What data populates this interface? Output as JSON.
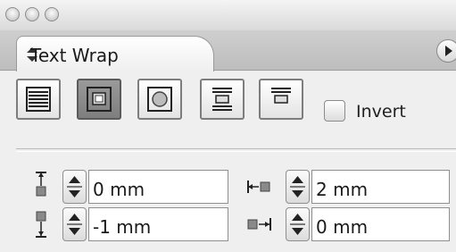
{
  "window": {
    "traffic_lights": [
      "close",
      "minimize",
      "zoom"
    ]
  },
  "tab": {
    "title": "Text Wrap",
    "menu_icon": "panel-menu-arrow-icon"
  },
  "wrap_options": [
    {
      "name": "no-text-wrap",
      "icon": "no-wrap-icon",
      "selected": false
    },
    {
      "name": "wrap-around-bounding-box",
      "icon": "bounding-box-wrap-icon",
      "selected": true
    },
    {
      "name": "wrap-around-object-shape",
      "icon": "object-shape-wrap-icon",
      "selected": false
    },
    {
      "name": "jump-object",
      "icon": "jump-object-wrap-icon",
      "selected": false
    },
    {
      "name": "jump-to-next-column",
      "icon": "jump-column-wrap-icon",
      "selected": false
    }
  ],
  "invert": {
    "label": "Invert",
    "checked": false
  },
  "offsets": {
    "top": {
      "value": "0 mm",
      "icon": "top-offset-icon"
    },
    "left": {
      "value": "2 mm",
      "icon": "left-offset-icon"
    },
    "bottom": {
      "value": "-1 mm",
      "icon": "bottom-offset-icon"
    },
    "right": {
      "value": "0 mm",
      "icon": "right-offset-icon"
    }
  }
}
